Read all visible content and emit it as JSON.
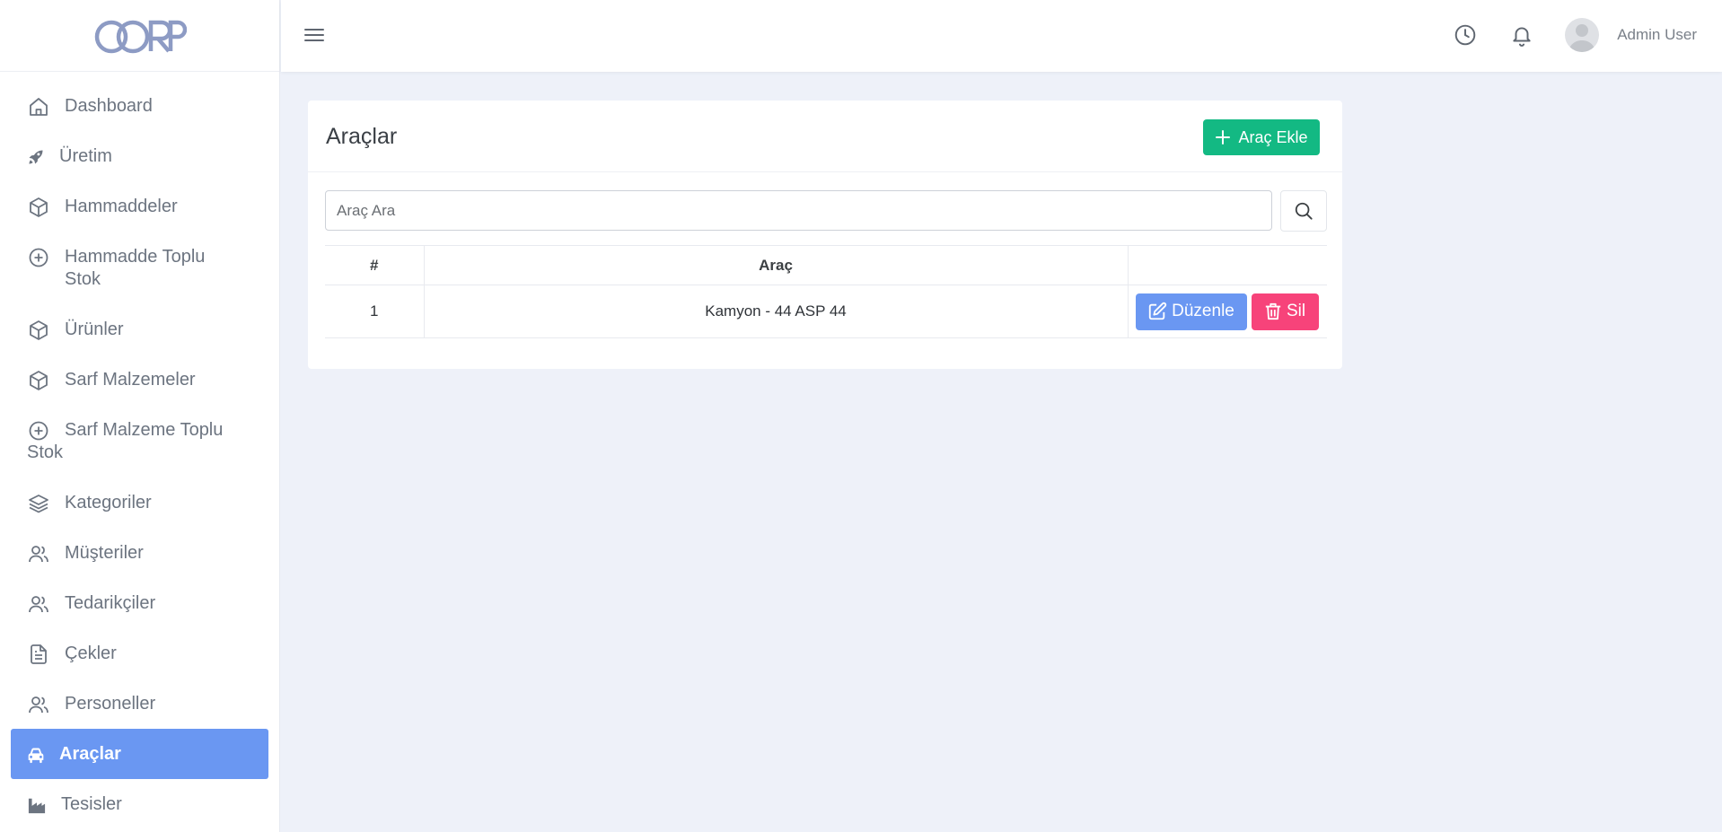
{
  "brand": {
    "logo_text": "CORP",
    "logo_color": "#8d9bc4"
  },
  "sidebar": {
    "items": [
      {
        "label": "Dashboard",
        "icon": "home-icon"
      },
      {
        "label": "Üretim",
        "icon": "rocket-icon"
      },
      {
        "label": "Hammaddeler",
        "icon": "box-icon"
      },
      {
        "label": "Hammadde Toplu Stok",
        "icon": "plus-circle-icon"
      },
      {
        "label": "Ürünler",
        "icon": "box-icon"
      },
      {
        "label": "Sarf Malzemeler",
        "icon": "box-icon"
      },
      {
        "label": "Sarf Malzeme Toplu Stok",
        "icon": "plus-circle-icon"
      },
      {
        "label": "Kategoriler",
        "icon": "layers-icon"
      },
      {
        "label": "Müşteriler",
        "icon": "users-icon"
      },
      {
        "label": "Tedarikçiler",
        "icon": "users-icon"
      },
      {
        "label": "Çekler",
        "icon": "file-text-icon"
      },
      {
        "label": "Personeller",
        "icon": "users-icon"
      },
      {
        "label": "Araçlar",
        "icon": "car-icon",
        "active": true
      },
      {
        "label": "Tesisler",
        "icon": "factory-icon"
      }
    ]
  },
  "topbar": {
    "user_name": "Admin User"
  },
  "page": {
    "title": "Araçlar",
    "add_label": "Araç Ekle",
    "search_placeholder": "Araç Ara",
    "table": {
      "headers": [
        "#",
        "Araç",
        ""
      ],
      "rows": [
        {
          "no": "1",
          "vehicle": "Kamyon - 44 ASP 44"
        }
      ]
    },
    "edit_label": "Düzenle",
    "delete_label": "Sil"
  },
  "colors": {
    "accent": "#6a97f2",
    "success": "#13b983",
    "danger": "#f7437a",
    "background": "#eef1f9"
  }
}
